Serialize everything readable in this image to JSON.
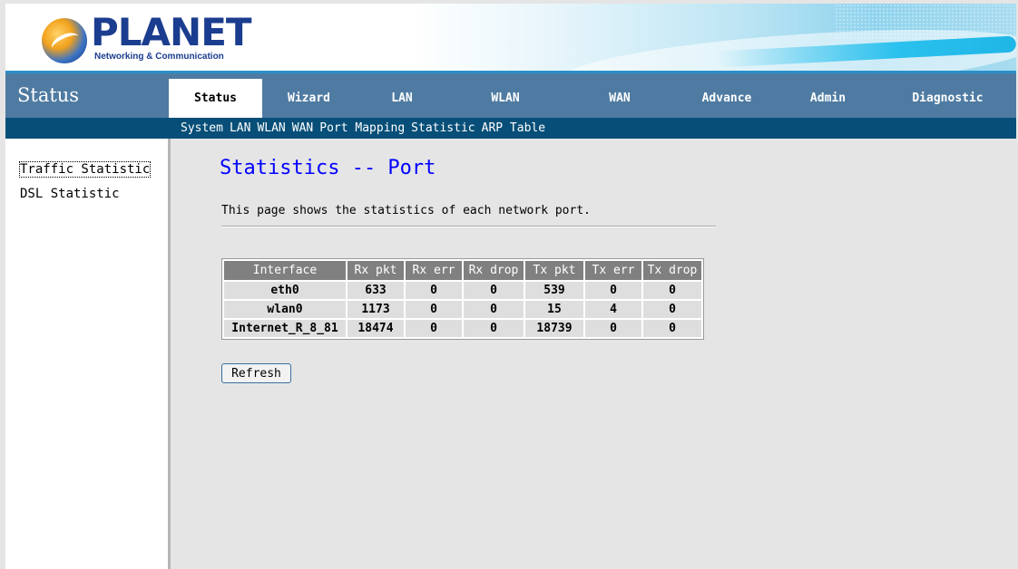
{
  "header": {
    "brand": "PLANET",
    "tagline": "Networking & Communication"
  },
  "nav": {
    "section_title": "Status",
    "tabs": [
      {
        "label": "Status",
        "active": true
      },
      {
        "label": "Wizard",
        "active": false
      },
      {
        "label": "LAN",
        "active": false
      },
      {
        "label": "WLAN",
        "active": false
      },
      {
        "label": "WAN",
        "active": false
      },
      {
        "label": "Advance",
        "active": false
      },
      {
        "label": "Admin",
        "active": false
      },
      {
        "label": "Diagnostic",
        "active": false
      }
    ]
  },
  "subnav": {
    "links": [
      "System",
      "LAN",
      "WLAN",
      "WAN",
      "Port Mapping",
      "Statistic",
      "ARP Table"
    ]
  },
  "sidebar": {
    "items": [
      {
        "label": "Traffic Statistic",
        "selected": true
      },
      {
        "label": "DSL Statistic",
        "selected": false
      }
    ]
  },
  "main": {
    "title": "Statistics -- Port",
    "description": "This page shows the statistics of each network port.",
    "table": {
      "headers": [
        "Interface",
        "Rx pkt",
        "Rx err",
        "Rx drop",
        "Tx pkt",
        "Tx err",
        "Tx drop"
      ],
      "rows": [
        [
          "eth0",
          "633",
          "0",
          "0",
          "539",
          "0",
          "0"
        ],
        [
          "wlan0",
          "1173",
          "0",
          "0",
          "15",
          "4",
          "0"
        ],
        [
          "Internet_R_8_81",
          "18474",
          "0",
          "0",
          "18739",
          "0",
          "0"
        ]
      ]
    },
    "refresh_label": "Refresh"
  },
  "colors": {
    "nav_bar": "#4f7ba2",
    "subnav_bar": "#074f78",
    "title_blue": "#0000ff",
    "table_header": "#808080",
    "table_cell": "#dedede"
  }
}
